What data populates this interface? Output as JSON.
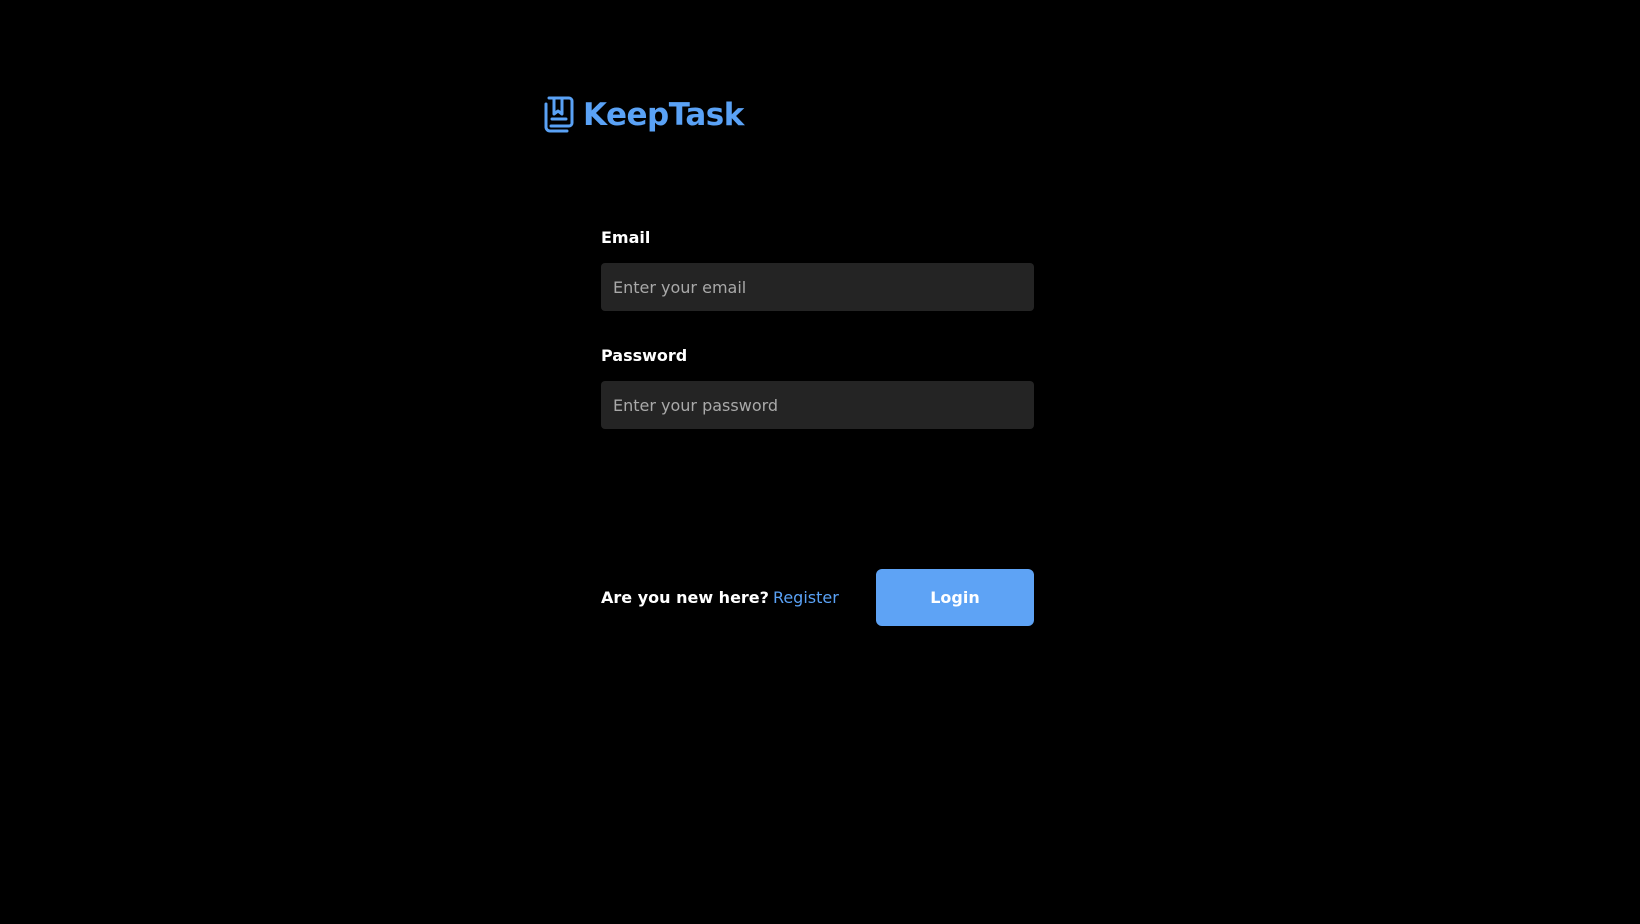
{
  "brand": {
    "name": "KeepTask",
    "icon": "bookmark-keep-icon",
    "color": "#5aa2f6"
  },
  "form": {
    "email": {
      "label": "Email",
      "placeholder": "Enter your email",
      "value": ""
    },
    "password": {
      "label": "Password",
      "placeholder": "Enter your password",
      "value": ""
    }
  },
  "footer": {
    "prompt": "Are you new here?",
    "register_label": "Register",
    "login_label": "Login"
  },
  "colors": {
    "background": "#000000",
    "input_background": "#242424",
    "accent": "#5aa2f6",
    "button": "#5ea3f5"
  }
}
